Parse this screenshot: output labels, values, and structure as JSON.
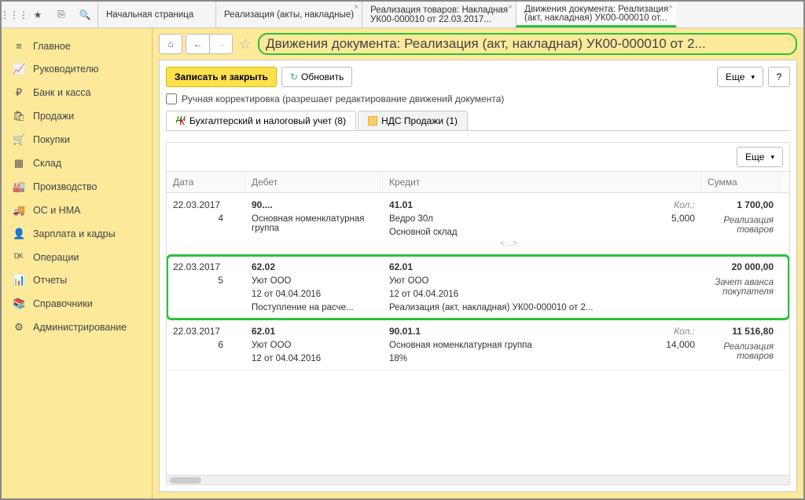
{
  "topIcons": [
    "⋮⋮⋮",
    "★",
    "⎘",
    "🔍"
  ],
  "tabs": [
    {
      "title": "Начальная страница",
      "sub": ""
    },
    {
      "title": "Реализация (акты, накладные)",
      "sub": ""
    },
    {
      "title": "Реализация товаров: Накладная",
      "sub": "УК00-000010 от 22.03.2017..."
    },
    {
      "title": "Движения документа: Реализация",
      "sub": "(акт, накладная) УК00-000010 от..."
    }
  ],
  "sidebar": [
    {
      "icon": "≡",
      "label": "Главное"
    },
    {
      "icon": "📈",
      "label": "Руководителю"
    },
    {
      "icon": "₽",
      "label": "Банк и касса"
    },
    {
      "icon": "🛍",
      "label": "Продажи"
    },
    {
      "icon": "🛒",
      "label": "Покупки"
    },
    {
      "icon": "▦",
      "label": "Склад"
    },
    {
      "icon": "🏭",
      "label": "Производство"
    },
    {
      "icon": "🚚",
      "label": "ОС и НМА"
    },
    {
      "icon": "👤",
      "label": "Зарплата и кадры"
    },
    {
      "icon": "ᴰᴷ",
      "label": "Операции"
    },
    {
      "icon": "📊",
      "label": "Отчеты"
    },
    {
      "icon": "📚",
      "label": "Справочники"
    },
    {
      "icon": "⚙",
      "label": "Администрирование"
    }
  ],
  "pageTitle": "Движения документа: Реализация (акт, накладная) УК00-000010 от 2...",
  "buttons": {
    "saveClose": "Записать и закрыть",
    "refresh": "Обновить",
    "more": "Еще",
    "help": "?"
  },
  "manualEdit": "Ручная корректировка (разрешает редактирование движений документа)",
  "subtabs": [
    {
      "label": "Бухгалтерский и налоговый учет (8)",
      "active": true
    },
    {
      "label": "НДС Продажи (1)",
      "active": false
    }
  ],
  "gridHeaders": {
    "date": "Дата",
    "debit": "Дебет",
    "credit": "Кредит",
    "sum": "Сумма"
  },
  "qtyLabel": "Кол.:",
  "entries": [
    {
      "date": "22.03.2017",
      "seq": "4",
      "debitMain": "90....",
      "debitSubs": [
        "Основная номенклатурная группа"
      ],
      "creditMain": "41.01",
      "creditSubs": [
        "Ведро 30л",
        "Основной склад",
        "<…>"
      ],
      "qty": "5,000",
      "sum": "1 700,00",
      "sumDesc": "Реализация товаров",
      "highlight": false
    },
    {
      "date": "22.03.2017",
      "seq": "5",
      "debitMain": "62.02",
      "debitSubs": [
        "Уют ООО",
        "12 от 04.04.2016",
        "Поступление на расче..."
      ],
      "creditMain": "62.01",
      "creditSubs": [
        "Уют ООО",
        "12 от 04.04.2016",
        "Реализация (акт, накладная) УК00-000010 от 2..."
      ],
      "qty": "",
      "sum": "20 000,00",
      "sumDesc": "Зачет аванса покупателя",
      "highlight": true,
      "wideCredit": true
    },
    {
      "date": "22.03.2017",
      "seq": "6",
      "debitMain": "62.01",
      "debitSubs": [
        "Уют ООО",
        "12 от 04.04.2016"
      ],
      "creditMain": "90.01.1",
      "creditSubs": [
        "Основная номенклатурная группа",
        "18%"
      ],
      "qty": "14,000",
      "sum": "11 516,80",
      "sumDesc": "Реализация товаров",
      "highlight": false
    }
  ]
}
